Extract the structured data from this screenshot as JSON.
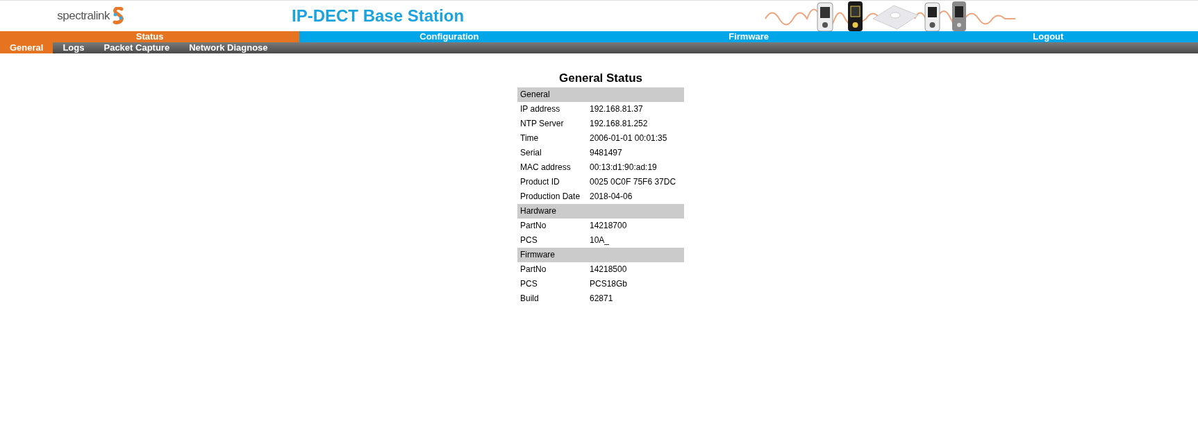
{
  "header": {
    "logo": "spectralink",
    "title": "IP-DECT Base Station"
  },
  "tabs": [
    {
      "label": "Status",
      "selected": true
    },
    {
      "label": "Configuration",
      "selected": false
    },
    {
      "label": "Firmware",
      "selected": false
    },
    {
      "label": "Logout",
      "selected": false
    }
  ],
  "subtabs": [
    {
      "label": "General",
      "selected": true
    },
    {
      "label": "Logs",
      "selected": false
    },
    {
      "label": "Packet Capture",
      "selected": false
    },
    {
      "label": "Network Diagnose",
      "selected": false
    }
  ],
  "status": {
    "title": "General Status",
    "sections": [
      {
        "heading": "General",
        "rows": [
          {
            "label": "IP address",
            "value": "192.168.81.37"
          },
          {
            "label": "NTP Server",
            "value": "192.168.81.252"
          },
          {
            "label": "Time",
            "value": "2006-01-01 00:01:35"
          },
          {
            "label": "Serial",
            "value": "9481497"
          },
          {
            "label": "MAC address",
            "value": "00:13:d1:90:ad:19"
          },
          {
            "label": "Product ID",
            "value": "0025 0C0F 75F6 37DC"
          },
          {
            "label": "Production Date",
            "value": "2018-04-06"
          }
        ]
      },
      {
        "heading": "Hardware",
        "rows": [
          {
            "label": "PartNo",
            "value": "14218700"
          },
          {
            "label": "PCS",
            "value": "10A_"
          }
        ]
      },
      {
        "heading": "Firmware",
        "rows": [
          {
            "label": "PartNo",
            "value": "14218500"
          },
          {
            "label": "PCS",
            "value": "PCS18Gb"
          },
          {
            "label": "Build",
            "value": "62871"
          }
        ]
      }
    ]
  }
}
